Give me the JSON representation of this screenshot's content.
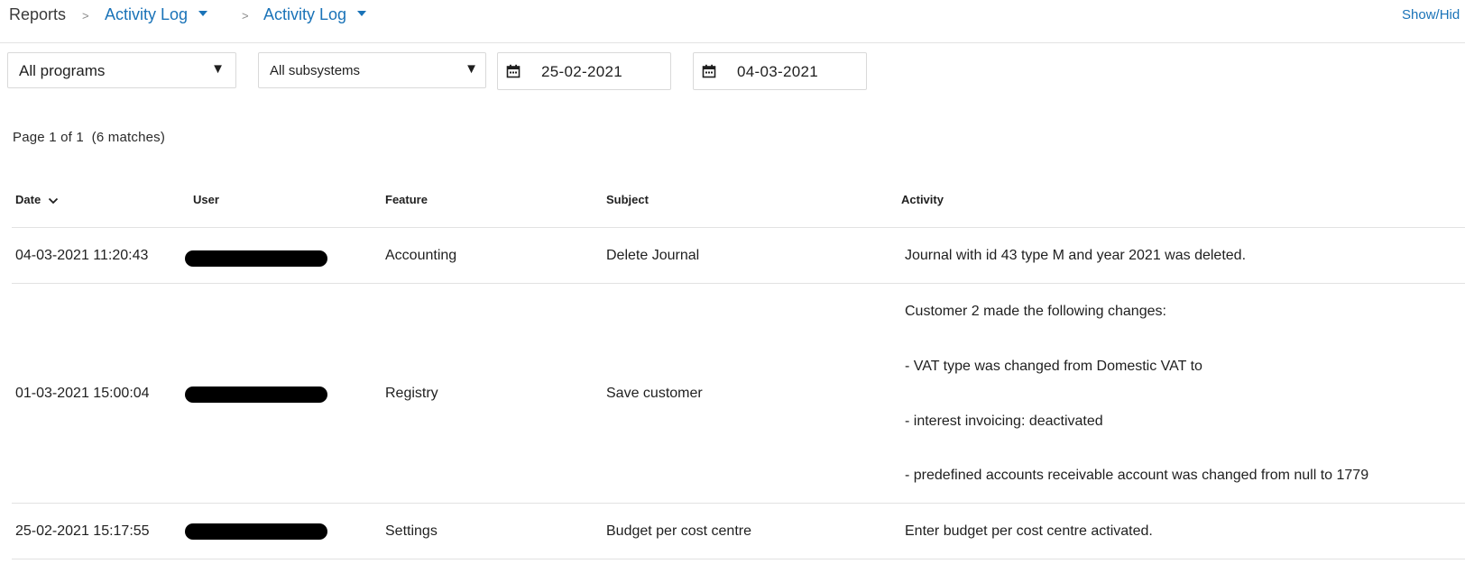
{
  "breadcrumb": {
    "root": "Reports",
    "separator": ">",
    "level1": "Activity Log",
    "level2": "Activity Log"
  },
  "actions": {
    "show_hide": "Show/Hid"
  },
  "filters": {
    "program": "All programs",
    "subsystem": "All subsystems",
    "date_from": "25-02-2021",
    "date_to": "04-03-2021"
  },
  "pagination": {
    "text": "Page 1 of 1  (6 matches)"
  },
  "table": {
    "columns": [
      "Date",
      "User",
      "Feature",
      "Subject",
      "Activity"
    ],
    "rows": [
      {
        "date": "04-03-2021 11:20:43",
        "user": "",
        "feature": "Accounting",
        "subject": "Delete Journal",
        "activity": [
          "Journal with id 43 type M and year 2021 was deleted."
        ]
      },
      {
        "date": "01-03-2021 15:00:04",
        "user": "",
        "feature": "Registry",
        "subject": "Save customer",
        "activity": [
          "Customer 2 made the following changes:",
          "- VAT type was changed from Domestic VAT to",
          "- interest invoicing: deactivated",
          "- predefined accounts receivable account was changed from null to 1779"
        ]
      },
      {
        "date": "25-02-2021 15:17:55",
        "user": "",
        "feature": "Settings",
        "subject": "Budget per cost centre",
        "activity": [
          "Enter budget per cost centre activated."
        ]
      }
    ]
  },
  "colors": {
    "accent": "#1a73b8",
    "border": "#e2e2e2",
    "text": "#1f1f1f"
  },
  "icons": {
    "calendar": "calendar-icon",
    "dropdown": "caret-down-icon",
    "sort": "chevron-down-icon"
  }
}
